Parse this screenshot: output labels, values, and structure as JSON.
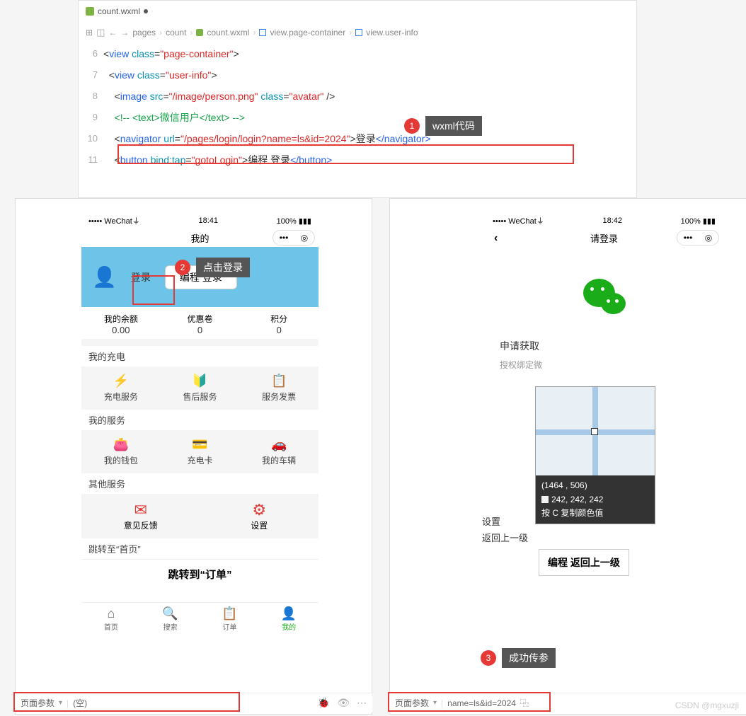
{
  "editor": {
    "tab_filename": "count.wxml",
    "breadcrumb": {
      "seg1": "pages",
      "seg2": "count",
      "seg3": "count.wxml",
      "seg4": "view.page-container",
      "seg5": "view.user-info"
    },
    "gutter": [
      "6",
      "7",
      "8",
      "9",
      "10",
      "11"
    ],
    "code": {
      "l6": {
        "p1": "<",
        "tag": "view ",
        "attr": "class",
        "eq": "=",
        "str": "\"page-container\"",
        "p2": ">"
      },
      "l7": {
        "p1": "  <",
        "tag": "view ",
        "attr": "class",
        "eq": "=",
        "str": "\"user-info\"",
        "p2": ">"
      },
      "l8": {
        "p1": "    <",
        "tag": "image ",
        "attr1": "src",
        "eq": "=",
        "str1": "\"/image/person.png\"",
        "sp": " ",
        "attr2": "class",
        "str2": "\"avatar\"",
        "p2": " />"
      },
      "l9": {
        "comment": "    <!-- <text>微信用户</text> -->"
      },
      "l10": {
        "p1": "    <",
        "tag": "navigator ",
        "attr": "url",
        "eq": "=",
        "str": "\"/pages/login/login?name=ls&id=2024\"",
        "p2": ">",
        "txt": "登录",
        "close": "</navigator>"
      },
      "l11": {
        "p1": "    <",
        "tag": "button ",
        "attr": "bind:tap",
        "eq": "=",
        "str": "\"gotoLogin\"",
        "p2": ">",
        "txt": "编程 登录",
        "close": "</button>"
      }
    }
  },
  "callouts": {
    "n1": "1",
    "l1": "wxml代码",
    "n2": "2",
    "l2": "点击登录",
    "n3": "3",
    "l3": "成功传参"
  },
  "phone1": {
    "carrier": "••••• WeChat",
    "signal": "⏚",
    "time": "18:41",
    "battery": "100%",
    "battery_icon": "▮▮▮",
    "title": "我的",
    "capsule_dots": "•••",
    "capsule_target": "◎",
    "login_text": "登录",
    "login_btn": "编程 登录",
    "stats": {
      "s1": "我的余额",
      "v1": "0.00",
      "s2": "优惠卷",
      "v2": "0",
      "s3": "积分",
      "v3": "0"
    },
    "sec1": "我的充电",
    "g1": "充电服务",
    "g2": "售后服务",
    "g3": "服务发票",
    "sec2": "我的服务",
    "g4": "我的钱包",
    "g5": "充电卡",
    "g6": "我的车辆",
    "sec3": "其他服务",
    "g7": "意见反馈",
    "g8": "设置",
    "jump_label": "跳转至“首页”",
    "jump_btn": "跳转到“订单”",
    "tabs": {
      "t1": "首页",
      "t2": "搜索",
      "t3": "订单",
      "t4": "我的"
    }
  },
  "phone2": {
    "carrier": "••••• WeChat",
    "signal": "⏚",
    "time": "18:42",
    "battery": "100%",
    "battery_icon": "▮▮▮",
    "title": "请登录",
    "capsule_dots": "•••",
    "capsule_target": "◎",
    "auth_title": "申请获取",
    "auth_sub": "授权绑定微",
    "links": "设置\n返回上一级",
    "back_btn": "编程 返回上一级",
    "picker": {
      "coord": "(1464 , 506)",
      "rgb": "242, 242, 242",
      "hint": "按 C 复制颜色值"
    }
  },
  "footer1": {
    "label": "页面参数",
    "val": "(空)"
  },
  "footer2": {
    "label": "页面参数",
    "val": "name=ls&id=2024",
    "copy": "⿻"
  },
  "watermark": "CSDN @mgxuzji"
}
